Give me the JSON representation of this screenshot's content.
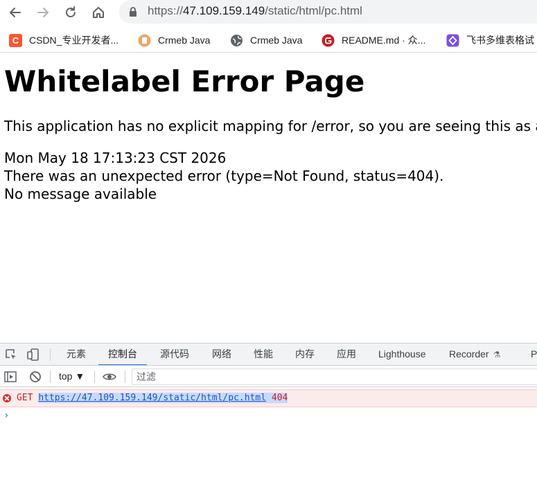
{
  "browser": {
    "url": {
      "scheme": "https://",
      "host": "47.109.159.149",
      "path": "/static/html/pc.html"
    },
    "bookmarks": [
      {
        "label": "CSDN_专业开发者...",
        "icon": "csdn-icon",
        "color": "#fc5531"
      },
      {
        "label": "Crmeb Java",
        "icon": "crmeb-icon",
        "color": "#e9a86a"
      },
      {
        "label": "Crmeb Java",
        "icon": "globe-icon",
        "color": "#5f6368"
      },
      {
        "label": "README.md · 众...",
        "icon": "gitee-icon",
        "color": "#c71d23"
      },
      {
        "label": "飞书多维表格试",
        "icon": "feishu-icon",
        "color": "#7b4fe0"
      }
    ]
  },
  "page": {
    "title": "Whitelabel Error Page",
    "lines": [
      "This application has no explicit mapping for /error, so you are seeing this as a fal",
      "Mon May 18 17:13:23 CST 2026",
      "There was an unexpected error (type=Not Found, status=404).",
      "No message available"
    ]
  },
  "devtools": {
    "tabs": [
      "元素",
      "控制台",
      "源代码",
      "网络",
      "性能",
      "内存",
      "应用",
      "Lighthouse",
      "Recorder",
      "P"
    ],
    "active_tab": "控制台",
    "context": "top ▼",
    "filter_placeholder": "过滤",
    "console": {
      "method": "GET",
      "url": "https://47.109.159.149/static/html/pc.html",
      "status": "404",
      "prompt": "›"
    }
  },
  "colors": {
    "accent": "#1a73e8",
    "error": "#c5221f"
  }
}
